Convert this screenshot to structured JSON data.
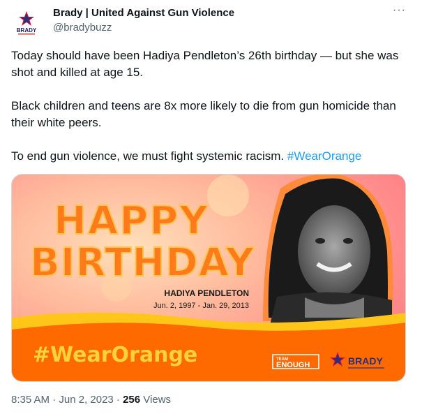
{
  "account": {
    "display_name": "Brady | United Against Gun Violence",
    "handle": "@bradybuzz",
    "avatar_text": "BRADY"
  },
  "more_label": "···",
  "tweet": {
    "paragraph1": "Today should have been Hadiya Pendleton’s 26th birthday — but she was shot and killed at age 15.",
    "paragraph2": "Black children and teens are 8x more likely to die from gun homicide than their white peers.",
    "paragraph3_text": "To end gun violence, we must fight systemic racism. ",
    "hashtag": "#WearOrange"
  },
  "image": {
    "line1": "HAPPY",
    "line2": "BIRTHDAY",
    "person_name": "HADIYA PENDLETON",
    "dates": "Jun. 2, 1997 - Jan. 29, 2013",
    "hashtag": "#WearOrange",
    "logo_team": "TEAM",
    "logo_enough": "ENOUGH",
    "logo_brady": "BRADY",
    "brand_orange": "#ff6a00",
    "brand_navy": "#1b1f5e"
  },
  "footer": {
    "timestamp": "8:35 AM · Jun 2, 2023 · ",
    "views_count": "256",
    "views_label": " Views"
  }
}
